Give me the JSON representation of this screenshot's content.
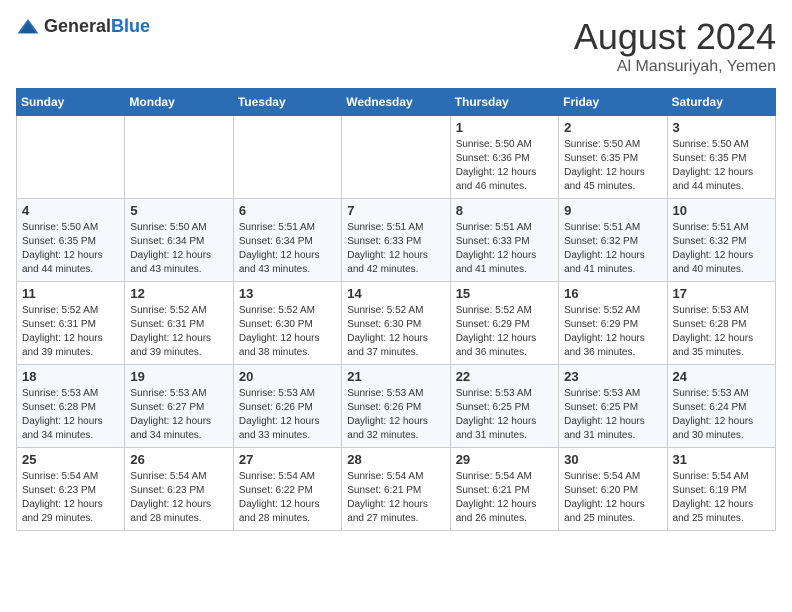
{
  "header": {
    "logo": {
      "text_general": "General",
      "text_blue": "Blue"
    },
    "title": "August 2024",
    "location": "Al Mansuriyah, Yemen"
  },
  "weekdays": [
    "Sunday",
    "Monday",
    "Tuesday",
    "Wednesday",
    "Thursday",
    "Friday",
    "Saturday"
  ],
  "weeks": [
    [
      {
        "day": "",
        "info": ""
      },
      {
        "day": "",
        "info": ""
      },
      {
        "day": "",
        "info": ""
      },
      {
        "day": "",
        "info": ""
      },
      {
        "day": "1",
        "info": "Sunrise: 5:50 AM\nSunset: 6:36 PM\nDaylight: 12 hours\nand 46 minutes."
      },
      {
        "day": "2",
        "info": "Sunrise: 5:50 AM\nSunset: 6:35 PM\nDaylight: 12 hours\nand 45 minutes."
      },
      {
        "day": "3",
        "info": "Sunrise: 5:50 AM\nSunset: 6:35 PM\nDaylight: 12 hours\nand 44 minutes."
      }
    ],
    [
      {
        "day": "4",
        "info": "Sunrise: 5:50 AM\nSunset: 6:35 PM\nDaylight: 12 hours\nand 44 minutes."
      },
      {
        "day": "5",
        "info": "Sunrise: 5:50 AM\nSunset: 6:34 PM\nDaylight: 12 hours\nand 43 minutes."
      },
      {
        "day": "6",
        "info": "Sunrise: 5:51 AM\nSunset: 6:34 PM\nDaylight: 12 hours\nand 43 minutes."
      },
      {
        "day": "7",
        "info": "Sunrise: 5:51 AM\nSunset: 6:33 PM\nDaylight: 12 hours\nand 42 minutes."
      },
      {
        "day": "8",
        "info": "Sunrise: 5:51 AM\nSunset: 6:33 PM\nDaylight: 12 hours\nand 41 minutes."
      },
      {
        "day": "9",
        "info": "Sunrise: 5:51 AM\nSunset: 6:32 PM\nDaylight: 12 hours\nand 41 minutes."
      },
      {
        "day": "10",
        "info": "Sunrise: 5:51 AM\nSunset: 6:32 PM\nDaylight: 12 hours\nand 40 minutes."
      }
    ],
    [
      {
        "day": "11",
        "info": "Sunrise: 5:52 AM\nSunset: 6:31 PM\nDaylight: 12 hours\nand 39 minutes."
      },
      {
        "day": "12",
        "info": "Sunrise: 5:52 AM\nSunset: 6:31 PM\nDaylight: 12 hours\nand 39 minutes."
      },
      {
        "day": "13",
        "info": "Sunrise: 5:52 AM\nSunset: 6:30 PM\nDaylight: 12 hours\nand 38 minutes."
      },
      {
        "day": "14",
        "info": "Sunrise: 5:52 AM\nSunset: 6:30 PM\nDaylight: 12 hours\nand 37 minutes."
      },
      {
        "day": "15",
        "info": "Sunrise: 5:52 AM\nSunset: 6:29 PM\nDaylight: 12 hours\nand 36 minutes."
      },
      {
        "day": "16",
        "info": "Sunrise: 5:52 AM\nSunset: 6:29 PM\nDaylight: 12 hours\nand 36 minutes."
      },
      {
        "day": "17",
        "info": "Sunrise: 5:53 AM\nSunset: 6:28 PM\nDaylight: 12 hours\nand 35 minutes."
      }
    ],
    [
      {
        "day": "18",
        "info": "Sunrise: 5:53 AM\nSunset: 6:28 PM\nDaylight: 12 hours\nand 34 minutes."
      },
      {
        "day": "19",
        "info": "Sunrise: 5:53 AM\nSunset: 6:27 PM\nDaylight: 12 hours\nand 34 minutes."
      },
      {
        "day": "20",
        "info": "Sunrise: 5:53 AM\nSunset: 6:26 PM\nDaylight: 12 hours\nand 33 minutes."
      },
      {
        "day": "21",
        "info": "Sunrise: 5:53 AM\nSunset: 6:26 PM\nDaylight: 12 hours\nand 32 minutes."
      },
      {
        "day": "22",
        "info": "Sunrise: 5:53 AM\nSunset: 6:25 PM\nDaylight: 12 hours\nand 31 minutes."
      },
      {
        "day": "23",
        "info": "Sunrise: 5:53 AM\nSunset: 6:25 PM\nDaylight: 12 hours\nand 31 minutes."
      },
      {
        "day": "24",
        "info": "Sunrise: 5:53 AM\nSunset: 6:24 PM\nDaylight: 12 hours\nand 30 minutes."
      }
    ],
    [
      {
        "day": "25",
        "info": "Sunrise: 5:54 AM\nSunset: 6:23 PM\nDaylight: 12 hours\nand 29 minutes."
      },
      {
        "day": "26",
        "info": "Sunrise: 5:54 AM\nSunset: 6:23 PM\nDaylight: 12 hours\nand 28 minutes."
      },
      {
        "day": "27",
        "info": "Sunrise: 5:54 AM\nSunset: 6:22 PM\nDaylight: 12 hours\nand 28 minutes."
      },
      {
        "day": "28",
        "info": "Sunrise: 5:54 AM\nSunset: 6:21 PM\nDaylight: 12 hours\nand 27 minutes."
      },
      {
        "day": "29",
        "info": "Sunrise: 5:54 AM\nSunset: 6:21 PM\nDaylight: 12 hours\nand 26 minutes."
      },
      {
        "day": "30",
        "info": "Sunrise: 5:54 AM\nSunset: 6:20 PM\nDaylight: 12 hours\nand 25 minutes."
      },
      {
        "day": "31",
        "info": "Sunrise: 5:54 AM\nSunset: 6:19 PM\nDaylight: 12 hours\nand 25 minutes."
      }
    ]
  ]
}
